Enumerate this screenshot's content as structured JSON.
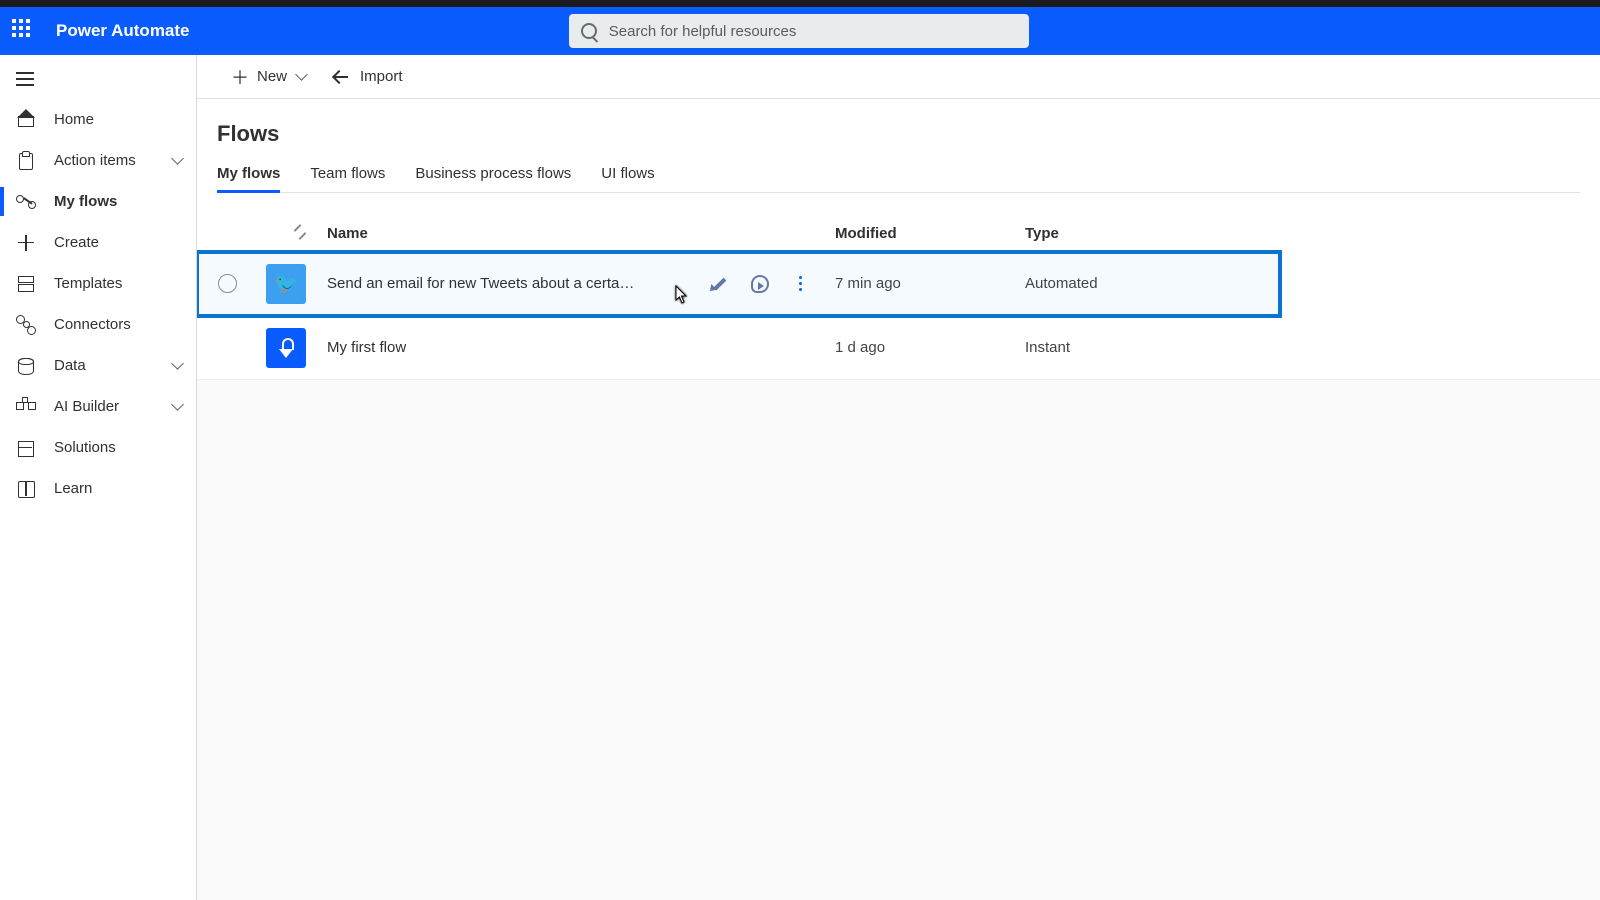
{
  "header": {
    "app_title": "Power Automate",
    "search_placeholder": "Search for helpful resources"
  },
  "sidebar": {
    "items": [
      {
        "label": "Home",
        "icon": "home-icon",
        "expandable": false,
        "active": false
      },
      {
        "label": "Action items",
        "icon": "clipboard-icon",
        "expandable": true,
        "active": false
      },
      {
        "label": "My flows",
        "icon": "flow-icon",
        "expandable": false,
        "active": true
      },
      {
        "label": "Create",
        "icon": "plus-icon",
        "expandable": false,
        "active": false
      },
      {
        "label": "Templates",
        "icon": "template-icon",
        "expandable": false,
        "active": false
      },
      {
        "label": "Connectors",
        "icon": "connector-icon",
        "expandable": false,
        "active": false
      },
      {
        "label": "Data",
        "icon": "database-icon",
        "expandable": true,
        "active": false
      },
      {
        "label": "AI Builder",
        "icon": "ai-icon",
        "expandable": true,
        "active": false
      },
      {
        "label": "Solutions",
        "icon": "solutions-icon",
        "expandable": false,
        "active": false
      },
      {
        "label": "Learn",
        "icon": "book-icon",
        "expandable": false,
        "active": false
      }
    ]
  },
  "command_bar": {
    "new_label": "New",
    "import_label": "Import"
  },
  "page": {
    "title": "Flows",
    "tabs": [
      {
        "label": "My flows",
        "active": true
      },
      {
        "label": "Team flows",
        "active": false
      },
      {
        "label": "Business process flows",
        "active": false
      },
      {
        "label": "UI flows",
        "active": false
      }
    ]
  },
  "table": {
    "columns": {
      "name": "Name",
      "modified": "Modified",
      "type": "Type"
    },
    "rows": [
      {
        "selected": true,
        "connector_icon": "twitter-icon",
        "name": "Send an email for new Tweets about a certain key...",
        "modified": "7 min ago",
        "type": "Automated"
      },
      {
        "selected": false,
        "connector_icon": "manual-trigger-icon",
        "name": "My first flow",
        "modified": "1 d ago",
        "type": "Instant"
      }
    ]
  }
}
